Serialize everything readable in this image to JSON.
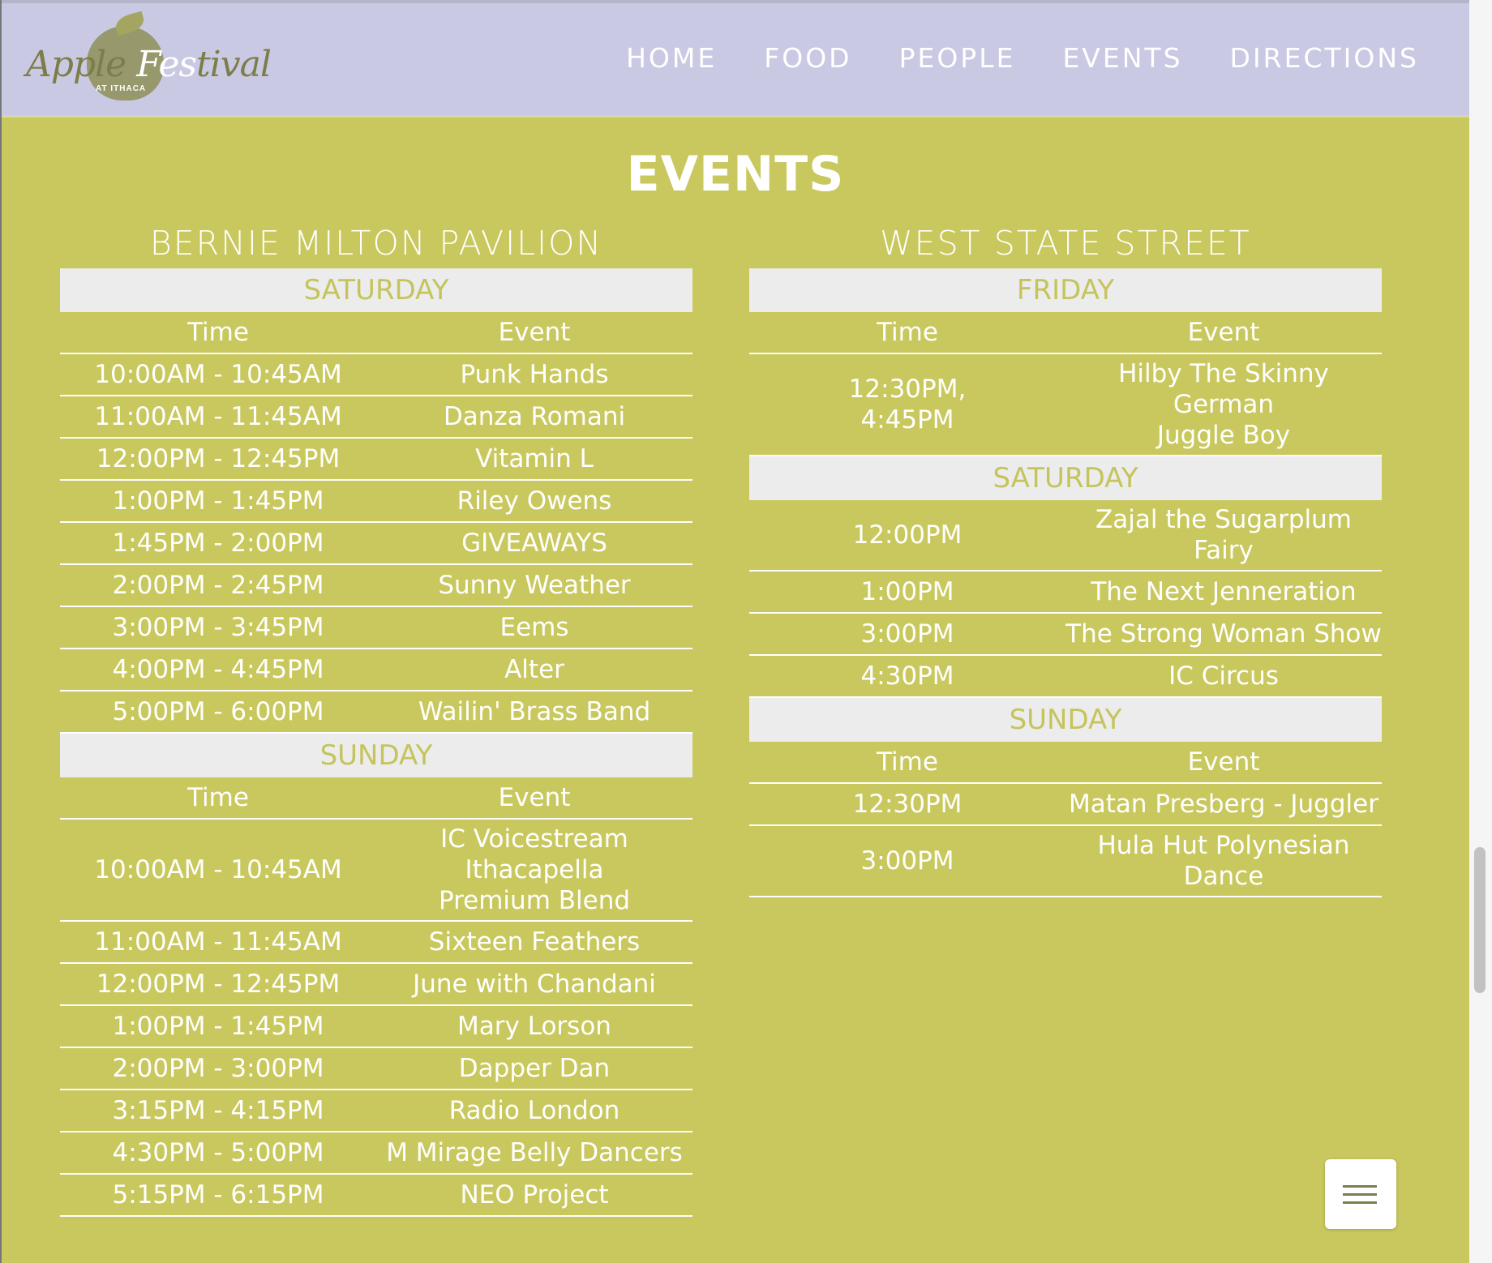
{
  "logo": {
    "text_a": "Apple ",
    "text_b": "Fes",
    "text_c": "tival",
    "sub": "AT ITHACA"
  },
  "nav": [
    "HOME",
    "FOOD",
    "PEOPLE",
    "EVENTS",
    "DIRECTIONS"
  ],
  "page_title": "EVENTS",
  "venues": [
    {
      "title": "BERNIE MILTON PAVILION",
      "days": [
        {
          "name": "SATURDAY",
          "header": {
            "time": "Time",
            "event": "Event"
          },
          "rows": [
            {
              "time": "10:00AM - 10:45AM",
              "event": "Punk Hands"
            },
            {
              "time": "11:00AM - 11:45AM",
              "event": "Danza Romani"
            },
            {
              "time": "12:00PM - 12:45PM",
              "event": "Vitamin L"
            },
            {
              "time": "1:00PM - 1:45PM",
              "event": "Riley Owens"
            },
            {
              "time": "1:45PM - 2:00PM",
              "event": "GIVEAWAYS"
            },
            {
              "time": "2:00PM - 2:45PM",
              "event": "Sunny Weather"
            },
            {
              "time": "3:00PM - 3:45PM",
              "event": "Eems"
            },
            {
              "time": "4:00PM - 4:45PM",
              "event": "Alter"
            },
            {
              "time": "5:00PM - 6:00PM",
              "event": "Wailin' Brass Band"
            }
          ]
        },
        {
          "name": "SUNDAY",
          "header": {
            "time": "Time",
            "event": "Event"
          },
          "rows": [
            {
              "time": "10:00AM - 10:45AM",
              "event": "IC Voicestream\nIthacapella\nPremium Blend"
            },
            {
              "time": "11:00AM - 11:45AM",
              "event": "Sixteen Feathers"
            },
            {
              "time": "12:00PM - 12:45PM",
              "event": "June with Chandani"
            },
            {
              "time": "1:00PM - 1:45PM",
              "event": "Mary Lorson"
            },
            {
              "time": "2:00PM - 3:00PM",
              "event": "Dapper Dan"
            },
            {
              "time": "3:15PM - 4:15PM",
              "event": "Radio London"
            },
            {
              "time": "4:30PM - 5:00PM",
              "event": "M Mirage Belly Dancers"
            },
            {
              "time": "5:15PM - 6:15PM",
              "event": "NEO Project"
            }
          ]
        }
      ]
    },
    {
      "title": "WEST STATE STREET",
      "days": [
        {
          "name": "FRIDAY",
          "header": {
            "time": "Time",
            "event": "Event"
          },
          "rows": [
            {
              "time": "12:30PM,\n4:45PM",
              "event": "Hilby The Skinny German\nJuggle Boy"
            }
          ]
        },
        {
          "name": "SATURDAY",
          "header": null,
          "rows": [
            {
              "time": "12:00PM",
              "event": "Zajal the Sugarplum Fairy"
            },
            {
              "time": "1:00PM",
              "event": "The Next Jenneration"
            },
            {
              "time": "3:00PM",
              "event": "The Strong Woman Show"
            },
            {
              "time": "4:30PM",
              "event": "IC Circus"
            }
          ]
        },
        {
          "name": "SUNDAY",
          "header": {
            "time": "Time",
            "event": "Event"
          },
          "rows": [
            {
              "time": "12:30PM",
              "event": "Matan Presberg - Juggler"
            },
            {
              "time": "3:00PM",
              "event": "Hula Hut Polynesian Dance"
            }
          ]
        }
      ]
    }
  ],
  "menu_button": {
    "icon": "hamburger-menu-icon"
  },
  "colors": {
    "nav_bg": "#c9c9e3",
    "page_bg": "#c9c85e",
    "day_bar_bg": "#ececec",
    "day_bar_text": "#c5c45c"
  }
}
